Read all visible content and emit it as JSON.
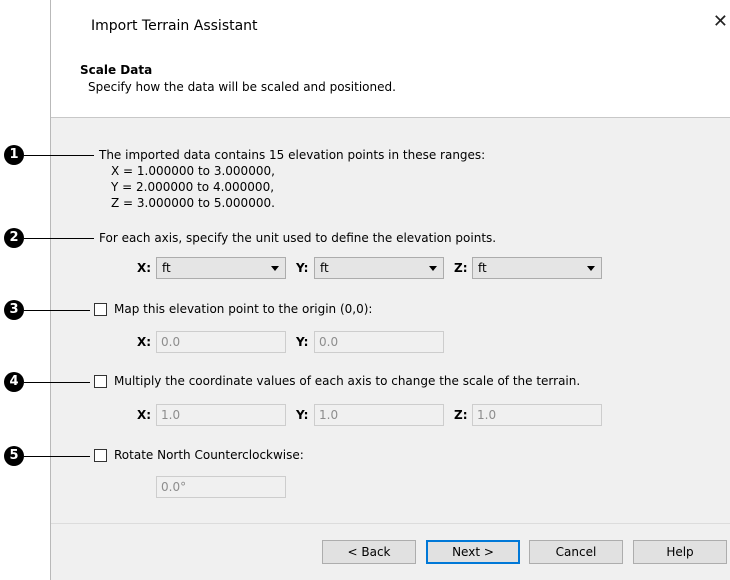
{
  "dialog": {
    "title": "Import Terrain Assistant",
    "close_glyph": "✕",
    "heading": "Scale Data",
    "subheading": "Specify how the data will be scaled and positioned."
  },
  "info": {
    "line1": "The imported data contains 15 elevation points in these ranges:",
    "x_range": "X = 1.000000 to 3.000000,",
    "y_range": "Y = 2.000000 to 4.000000,",
    "z_range": "Z = 3.000000 to 5.000000."
  },
  "units": {
    "prompt": "For each axis, specify the unit used to define the elevation points.",
    "x_label": "X:",
    "y_label": "Y:",
    "z_label": "Z:",
    "x_value": "ft",
    "y_value": "ft",
    "z_value": "ft"
  },
  "origin": {
    "checkbox_label": "Map this elevation point to the origin (0,0):",
    "checked": false,
    "x_label": "X:",
    "y_label": "Y:",
    "x_value": "0.0",
    "y_value": "0.0"
  },
  "scale": {
    "checkbox_label": "Multiply the coordinate values of each axis to change the scale of the terrain.",
    "checked": false,
    "x_label": "X:",
    "y_label": "Y:",
    "z_label": "Z:",
    "x_value": "1.0",
    "y_value": "1.0",
    "z_value": "1.0"
  },
  "rotate": {
    "checkbox_label": "Rotate North Counterclockwise:",
    "checked": false,
    "value": "0.0°"
  },
  "buttons": {
    "back": "< Back",
    "next": "Next >",
    "cancel": "Cancel",
    "help": "Help"
  },
  "callouts": [
    "1",
    "2",
    "3",
    "4",
    "5"
  ],
  "colors": {
    "dialog_bg": "#f0f0f0",
    "header_bg": "#ffffff",
    "default_button_border": "#0078d7",
    "callout_bg": "#000000"
  }
}
